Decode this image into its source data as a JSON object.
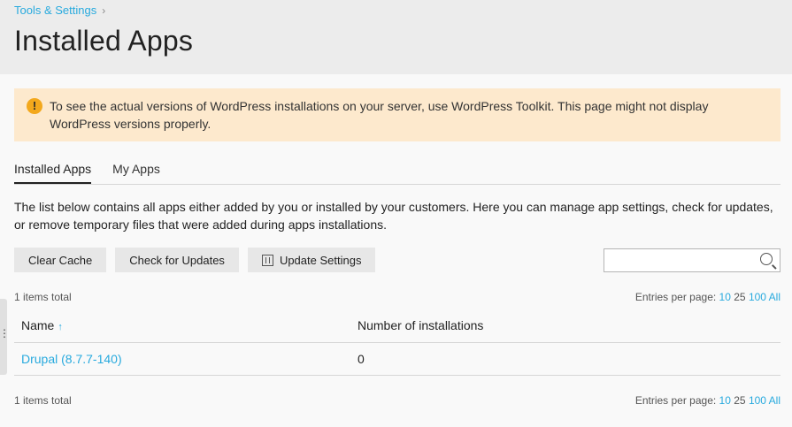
{
  "breadcrumb": {
    "label": "Tools & Settings",
    "chevron": "›"
  },
  "page": {
    "title": "Installed Apps"
  },
  "alert": {
    "icon": "!",
    "text": "To see the actual versions of WordPress installations on your server, use WordPress Toolkit. This page might not display WordPress versions properly."
  },
  "tabs": [
    {
      "label": "Installed Apps",
      "active": true
    },
    {
      "label": "My Apps",
      "active": false
    }
  ],
  "intro": "The list below contains all apps either added by you or installed by your customers. Here you can manage app settings, check for updates, or remove temporary files that were added during apps installations.",
  "toolbar": {
    "clear_cache": "Clear Cache",
    "check_updates": "Check for Updates",
    "update_settings": "Update Settings"
  },
  "search": {
    "placeholder": ""
  },
  "top_meta": {
    "items_total": "1 items total",
    "entries_label": "Entries per page:",
    "options": [
      "10",
      "25",
      "100",
      "All"
    ],
    "selected": "25"
  },
  "bottom_meta": {
    "items_total": "1 items total",
    "entries_label": "Entries per page:",
    "options": [
      "10",
      "25",
      "100",
      "All"
    ],
    "selected": "25"
  },
  "table": {
    "columns": [
      "Name",
      "Number of installations"
    ],
    "sort_indicator": "↑",
    "rows": [
      {
        "name": "Drupal (8.7.7-140)",
        "installations": "0"
      }
    ]
  },
  "colors": {
    "accent": "#28aade",
    "alert_bg": "#fde9cd",
    "alert_icon": "#f3a81c",
    "header_bg": "#ececec"
  }
}
